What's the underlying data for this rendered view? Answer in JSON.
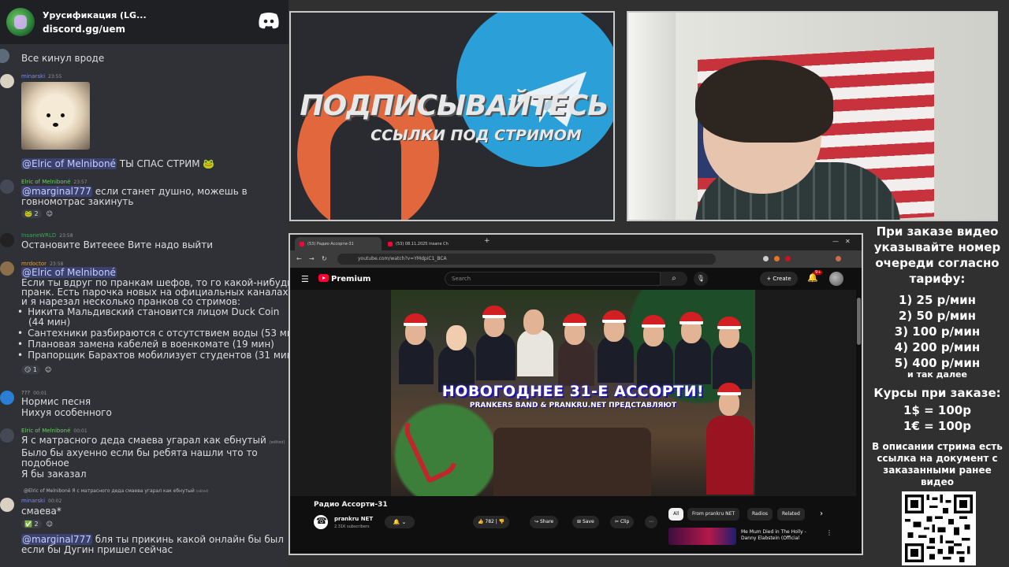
{
  "discord": {
    "server_name": "Урусификация (LG...",
    "invite": "discord.gg/uem",
    "messages": [
      {
        "text": "Все кинул вроде"
      },
      {
        "user": "minarski",
        "time": "23:55"
      },
      {
        "mention": "@Elric of Melniboné",
        "text": "ТЫ СПАС СТРИМ"
      },
      {
        "user": "Elric of Melniboné",
        "time": "23:57",
        "mention": "@marginal777",
        "line1": "если станет душно, можешь в",
        "line2": "говномотрас закинуть",
        "react_count": "2"
      },
      {
        "user": "InsaneWRLD",
        "time": "23:58",
        "text": "Остановите Витееее Вите надо выйти"
      },
      {
        "user": "mrdoctor",
        "time": "23:58",
        "mention": "@Elric of Melniboné",
        "line1": "Если ты вдруг по пранкам шефов, то го какой-нибудь",
        "line2": "пранк. Есть парочка новых на официальных каналах,",
        "line3": "и я нарезал несколько пранков со стримов:",
        "bullets": [
          "Никита Мальдивский становится лицом Duck Coin",
          "(44 мин)",
          "Сантехники разбираются с отсутствием воды (53 мин",
          "Плановая замена кабелей в военкомате (19 мин)",
          "Прапорщик Барахтов мобилизует студентов (31 мин)"
        ],
        "react_count": "1"
      },
      {
        "user": "???",
        "time": "00:01",
        "line1": "Нормис песня",
        "line2": "Нихуя особенного"
      },
      {
        "user": "Elric of Melniboné",
        "time": "00:01",
        "line1": "Я с матрасного деда смаева угарал как ебнутый",
        "edited": "(edited)",
        "line2": "Было бы ахуенно если бы ребята нашли что то",
        "line3": "подобное",
        "line4": "Я бы заказал"
      },
      {
        "reply": "@Elric of Melniboné Я с матрасного деда смаева угарал как ебнутый",
        "reply_edited": "(edited)",
        "user": "minarski",
        "time": "00:02",
        "text": "смаева*",
        "react_count": "2"
      },
      {
        "mention": "@marginal777",
        "line1": "бля ты прикинь какой онлайн бы был",
        "line2": "если бы Дугин пришел сейчас"
      }
    ]
  },
  "promo": {
    "title": "ПОДПИСЫВАЙТЕСЬ",
    "subtitle": "ССЫЛКИ ПОД СТРИМОМ"
  },
  "browser": {
    "tab1": "(53) Радио Ассорти-31",
    "tab2": "(53) 08.11.2025 insane Ch",
    "url": "youtube.com/watch?v=YMdpiC1_BCA",
    "yt_brand": "Premium",
    "search_placeholder": "Search",
    "create_label": "Create",
    "notif_count": "9+",
    "thumb_title": "НОВОГОДНЕЕ 31-Е АССОРТИ!",
    "thumb_subtitle": "PRANKERS BAND & PRANKRU.NET ПРЕДСТАВЛЯЮТ",
    "video_title": "Радио Ассорти-31",
    "channel_name": "prankru NET",
    "channel_subs": "2.31K subscribers",
    "likes": "782",
    "share_label": "Share",
    "save_label": "Save",
    "clip_label": "Clip",
    "chips": [
      "All",
      "From prankru NET",
      "Radios",
      "Related"
    ],
    "rec_title": "Me Mum Died in The Holly - Danny Elabstein (Official"
  },
  "order": {
    "header": "При заказе видео указывайте номер очереди согласно тарифу:",
    "prices": [
      "1) 25 р/мин",
      "2) 50 р/мин",
      "3) 100 р/мин",
      "4) 200 р/мин",
      "5) 400 р/мин"
    ],
    "etc": "и так далее",
    "rates_header": "Курсы при заказе:",
    "rates": [
      "1$ = 100р",
      "1€ = 100р"
    ],
    "description": "В описании стрима есть ссылка на документ с заказанными ранее видео"
  }
}
